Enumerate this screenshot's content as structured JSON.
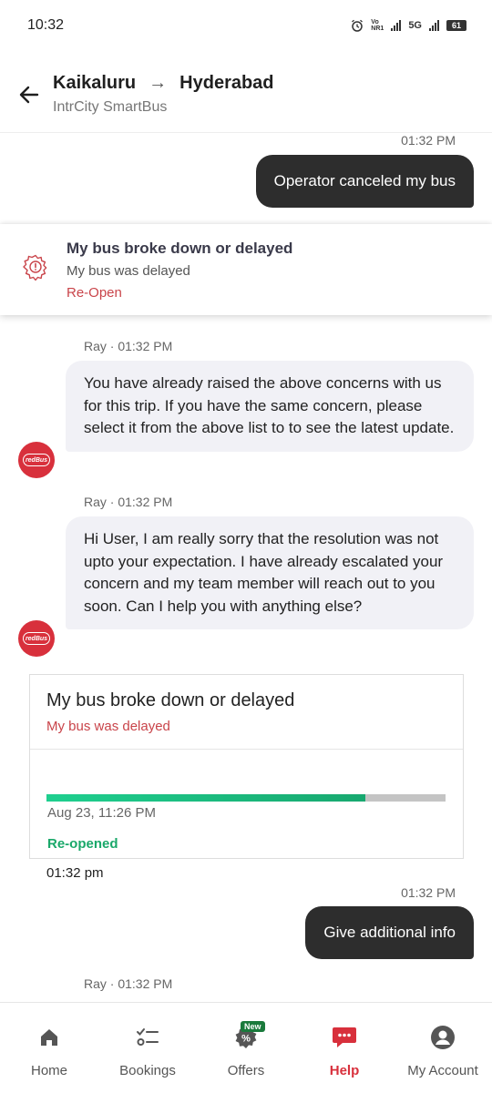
{
  "status_bar": {
    "time": "10:32",
    "volte": "Vo\nNR1",
    "network": "5G",
    "battery": "61"
  },
  "header": {
    "from": "Kaikaluru",
    "to": "Hyderabad",
    "operator": "IntrCity SmartBus"
  },
  "chat": {
    "msg1_time": "01:32 PM",
    "msg1_text": "Operator canceled my bus",
    "issue_card": {
      "title": "My bus broke down or delayed",
      "subtitle": "My bus was delayed",
      "action": "Re-Open"
    },
    "agent1_label": "Ray · 01:32 PM",
    "agent1_text": "You have already raised the above concerns with us for this trip. If you have the same concern, please select it from the above list to to see the latest update.",
    "agent2_label": "Ray · 01:32 PM",
    "agent2_text": "Hi User, I am really sorry that the resolution was not upto your expectation. I have already escalated your concern and my team member will reach out to you soon. Can I help you with anything else?",
    "avatar_text": "redBus",
    "status_card": {
      "title": "My bus broke down or delayed",
      "subtitle": "My bus was delayed",
      "progress": 0.8,
      "date": "Aug 23, 11:26 PM",
      "status": "Re-opened"
    },
    "card_time": "01:32 pm",
    "msg2_time": "01:32 PM",
    "msg2_text": "Give additional info",
    "agent3_label": "Ray · 01:32 PM"
  },
  "bottom_nav": {
    "items": [
      {
        "label": "Home",
        "icon": "home-icon"
      },
      {
        "label": "Bookings",
        "icon": "bookings-icon"
      },
      {
        "label": "Offers",
        "icon": "offers-icon",
        "badge": "New"
      },
      {
        "label": "Help",
        "icon": "help-chat-icon",
        "active": true
      },
      {
        "label": "My Account",
        "icon": "account-icon"
      }
    ]
  },
  "colors": {
    "brand_red": "#d8303c",
    "reopen_red": "#c9444a",
    "success_green": "#1aa86a",
    "user_bubble": "#2d2d2d",
    "agent_bubble": "#f1f1f6"
  }
}
